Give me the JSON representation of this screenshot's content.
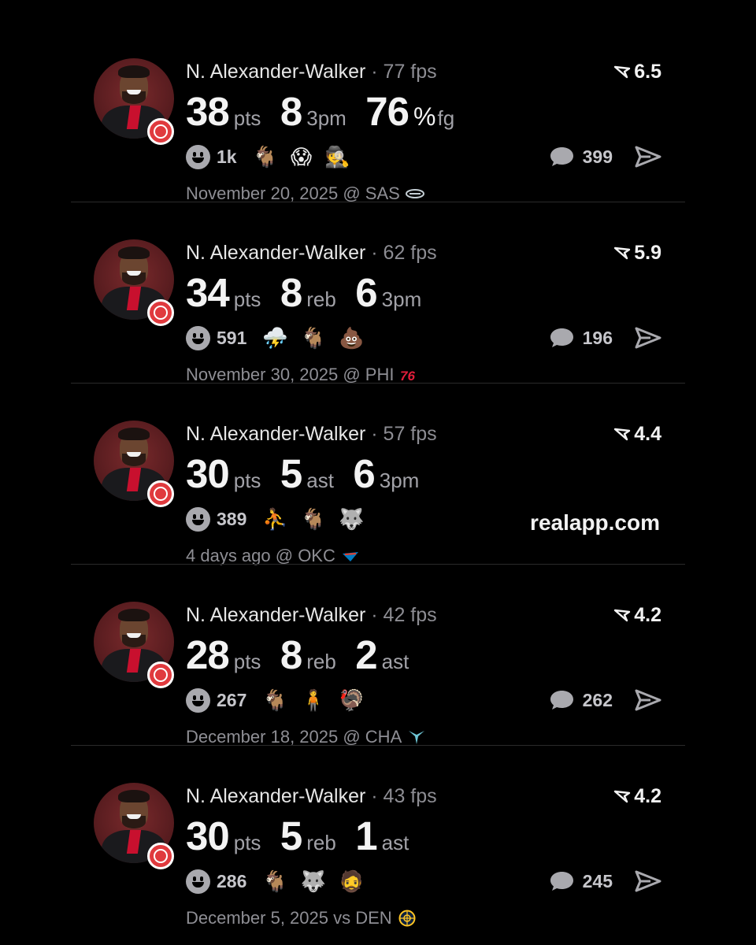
{
  "cards": [
    {
      "name": "N. Alexander-Walker",
      "fps": "· 77 fps",
      "rating": "6.5",
      "stats": [
        {
          "value": "38",
          "unit": "pts"
        },
        {
          "value": "8",
          "unit": "3pm"
        },
        {
          "value": "76",
          "pct": "%",
          "unit": "fg"
        }
      ],
      "reactions": "1k",
      "emojis": [
        "🐐",
        "😱",
        "🕵️"
      ],
      "comments": "399",
      "date": "November 20, 2025 @ SAS",
      "team_logo": "spurs-logo"
    },
    {
      "name": "N. Alexander-Walker",
      "fps": "· 62 fps",
      "rating": "5.9",
      "stats": [
        {
          "value": "34",
          "unit": "pts"
        },
        {
          "value": "8",
          "unit": "reb"
        },
        {
          "value": "6",
          "unit": "3pm"
        }
      ],
      "reactions": "591",
      "emojis": [
        "⛈️",
        "🐐",
        "💩"
      ],
      "comments": "196",
      "date": "November 30, 2025 @ PHI",
      "team_logo": "76ers-logo"
    },
    {
      "name": "N. Alexander-Walker",
      "fps": "· 57 fps",
      "rating": "4.4",
      "stats": [
        {
          "value": "30",
          "unit": "pts"
        },
        {
          "value": "5",
          "unit": "ast"
        },
        {
          "value": "6",
          "unit": "3pm"
        }
      ],
      "reactions": "389",
      "emojis": [
        "⛹️",
        "🐐",
        "🐺"
      ],
      "promo": "realapp.com",
      "date": "4 days ago @ OKC",
      "team_logo": "thunder-logo"
    },
    {
      "name": "N. Alexander-Walker",
      "fps": "· 42 fps",
      "rating": "4.2",
      "stats": [
        {
          "value": "28",
          "unit": "pts"
        },
        {
          "value": "8",
          "unit": "reb"
        },
        {
          "value": "2",
          "unit": "ast"
        }
      ],
      "reactions": "267",
      "emojis": [
        "🐐",
        "🧍",
        "🦃"
      ],
      "comments": "262",
      "date": "December 18, 2025 @ CHA",
      "team_logo": "hornets-logo"
    },
    {
      "name": "N. Alexander-Walker",
      "fps": "· 43 fps",
      "rating": "4.2",
      "stats": [
        {
          "value": "30",
          "unit": "pts"
        },
        {
          "value": "5",
          "unit": "reb"
        },
        {
          "value": "1",
          "unit": "ast"
        }
      ],
      "reactions": "286",
      "emojis": [
        "🐐",
        "🐺",
        "🧔"
      ],
      "comments": "245",
      "date": "December 5, 2025 vs DEN",
      "team_logo": "nuggets-logo"
    }
  ],
  "colors": {
    "background": "#000000",
    "text": "#ececec",
    "muted": "#8e8e94",
    "hawks_red": "#e03a3e"
  }
}
